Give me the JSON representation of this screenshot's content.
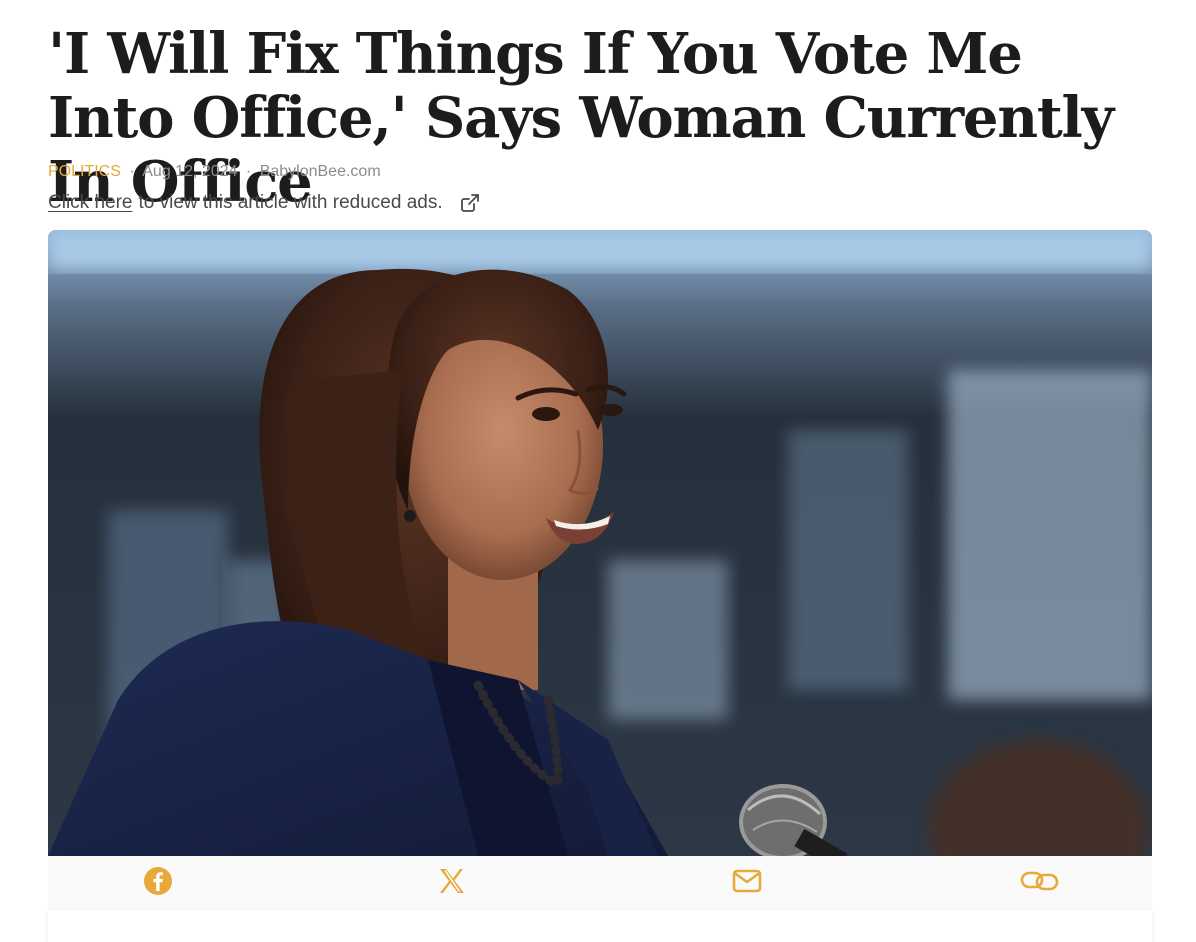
{
  "article": {
    "headline": "'I Will Fix Things If You Vote Me Into Office,' Says Woman Currently In Office",
    "category": "POLITICS",
    "date": "Aug 12, 2024",
    "source": "BabylonBee.com",
    "separator": "·"
  },
  "reduced_ads": {
    "link_text": "Click here",
    "rest_text": "to view this article with reduced ads.",
    "icon": "external-link-icon"
  },
  "hero_image": {
    "alt": "Smiling woman in navy blazer speaking at a microphone"
  },
  "share_bar": {
    "items": [
      {
        "icon": "facebook-icon"
      },
      {
        "icon": "x-icon"
      },
      {
        "icon": "mail-icon"
      },
      {
        "icon": "link-icon"
      }
    ]
  },
  "colors": {
    "accent": "#e8a93a",
    "meta_text": "#8c8c8c",
    "headline": "#1c1c1c",
    "share_bar_bg": "#fafafa"
  }
}
